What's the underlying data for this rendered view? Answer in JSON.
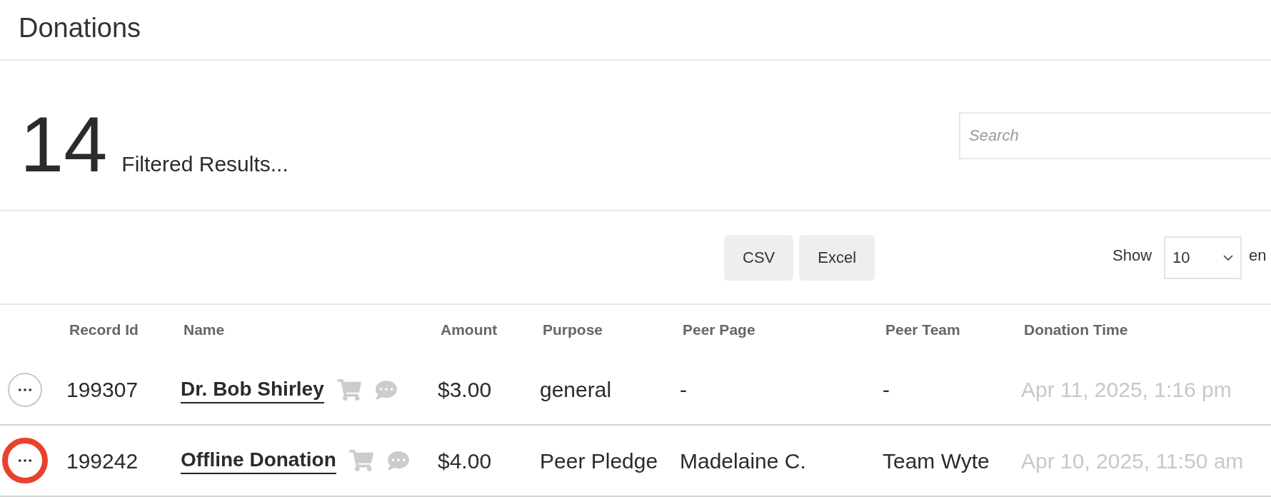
{
  "page": {
    "title": "Donations"
  },
  "summary": {
    "count": "14",
    "label": "Filtered Results..."
  },
  "search": {
    "placeholder": "Search"
  },
  "export_buttons": [
    "CSV",
    "Excel"
  ],
  "page_length": {
    "label": "Show",
    "value": "10",
    "suffix": "en"
  },
  "table": {
    "columns": [
      "Record Id",
      "Name",
      "Amount",
      "Purpose",
      "Peer Page",
      "Peer Team",
      "Donation Time"
    ],
    "rows": [
      {
        "actions_highlighted": false,
        "record_id": "199307",
        "name": "Dr. Bob Shirley",
        "amount": "$3.00",
        "purpose": "general",
        "peer_page": "-",
        "peer_team": "-",
        "donation_time": "Apr 11, 2025, 1:16 pm"
      },
      {
        "actions_highlighted": true,
        "record_id": "199242",
        "name": "Offline Donation",
        "amount": "$4.00",
        "purpose": "Peer Pledge",
        "peer_page": "Madelaine C.",
        "peer_team": "Team Wyte",
        "donation_time": "Apr 10, 2025, 11:50 am"
      }
    ]
  }
}
